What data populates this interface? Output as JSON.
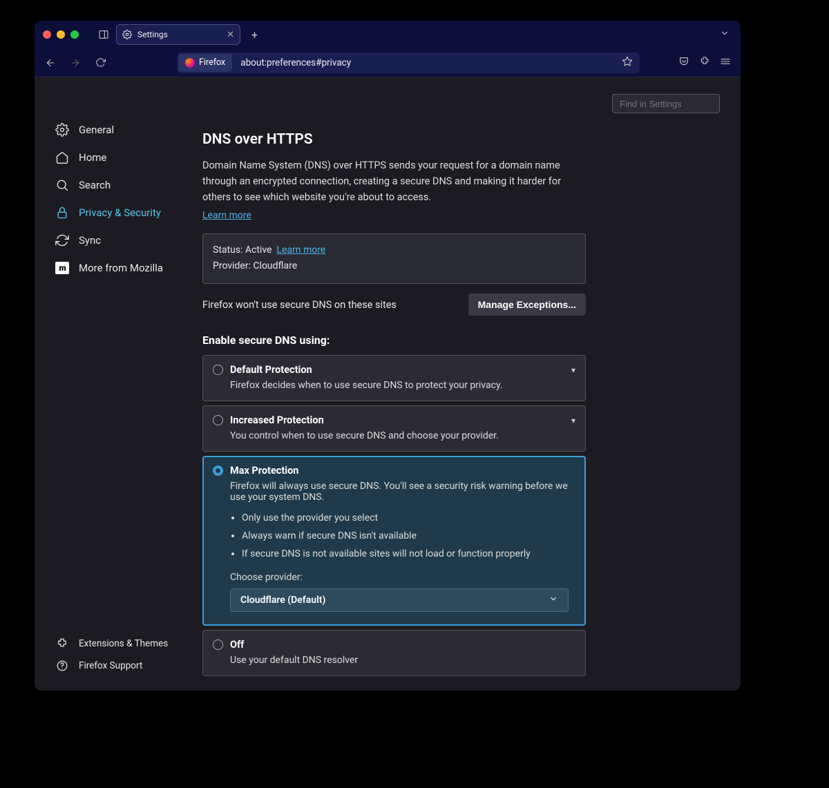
{
  "tab": {
    "title": "Settings"
  },
  "url": {
    "identity": "Firefox",
    "address": "about:preferences#privacy"
  },
  "search": {
    "placeholder": "Find in Settings"
  },
  "sidebar": {
    "items": [
      {
        "label": "General"
      },
      {
        "label": "Home"
      },
      {
        "label": "Search"
      },
      {
        "label": "Privacy & Security"
      },
      {
        "label": "Sync"
      },
      {
        "label": "More from Mozilla"
      }
    ],
    "footer": [
      {
        "label": "Extensions & Themes"
      },
      {
        "label": "Firefox Support"
      }
    ]
  },
  "section": {
    "title": "DNS over HTTPS",
    "desc": "Domain Name System (DNS) over HTTPS sends your request for a domain name through an encrypted connection, creating a secure DNS and making it harder for others to see which website you're about to access.",
    "learn_more": "Learn more",
    "status_label": "Status: Active",
    "status_learn": "Learn more",
    "provider_line": "Provider: Cloudflare",
    "exceptions_text": "Firefox won't use secure DNS on these sites",
    "exceptions_btn": "Manage Exceptions...",
    "enable_head": "Enable secure DNS using:",
    "options": {
      "default": {
        "title": "Default Protection",
        "sub": "Firefox decides when to use secure DNS to protect your privacy."
      },
      "increased": {
        "title": "Increased Protection",
        "sub": "You control when to use secure DNS and choose your provider."
      },
      "max": {
        "title": "Max Protection",
        "sub": "Firefox will always use secure DNS. You'll see a security risk warning before we use your system DNS.",
        "bullets": [
          "Only use the provider you select",
          "Always warn if secure DNS isn't available",
          "If secure DNS is not available sites will not load or function properly"
        ],
        "choose_label": "Choose provider:",
        "provider_value": "Cloudflare (Default)"
      },
      "off": {
        "title": "Off",
        "sub": "Use your default DNS resolver"
      }
    }
  }
}
